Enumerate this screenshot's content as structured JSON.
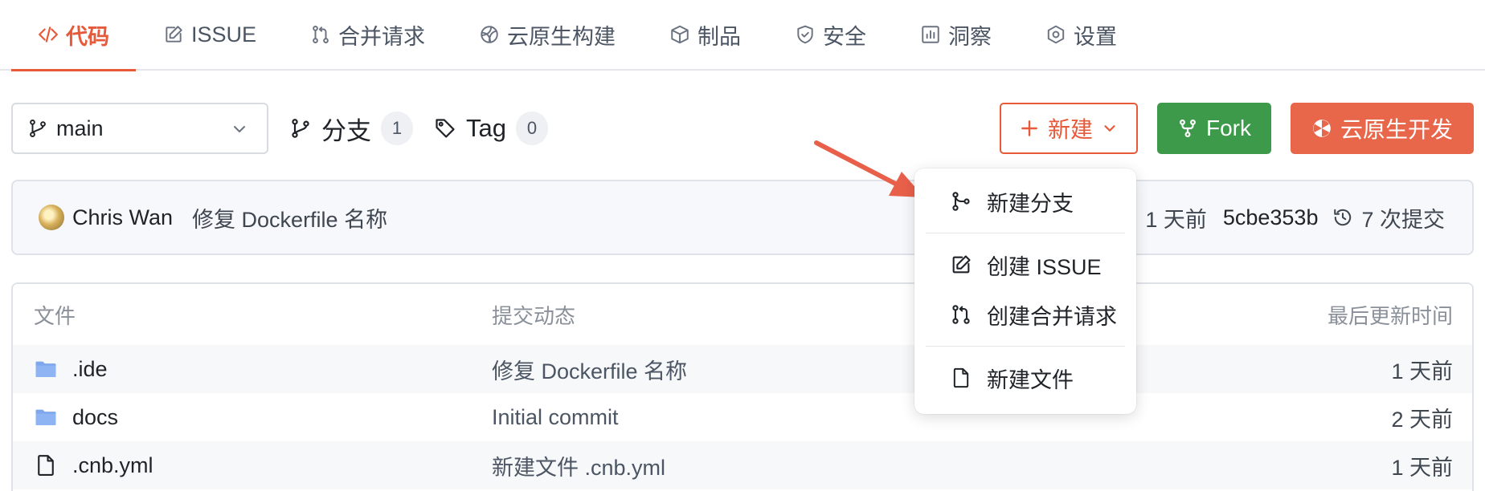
{
  "tabs": [
    {
      "label": "代码",
      "icon": "code-icon",
      "active": true
    },
    {
      "label": "ISSUE",
      "icon": "issue-icon",
      "active": false
    },
    {
      "label": "合并请求",
      "icon": "pull-request-icon",
      "active": false
    },
    {
      "label": "云原生构建",
      "icon": "build-icon",
      "active": false
    },
    {
      "label": "制品",
      "icon": "package-icon",
      "active": false
    },
    {
      "label": "安全",
      "icon": "shield-icon",
      "active": false
    },
    {
      "label": "洞察",
      "icon": "chart-icon",
      "active": false
    },
    {
      "label": "设置",
      "icon": "gear-icon",
      "active": false
    }
  ],
  "toolbar": {
    "branch": "main",
    "branches_label": "分支",
    "branches_count": "1",
    "tags_label": "Tag",
    "tags_count": "0",
    "new_label": "新建",
    "new_prefix": "+",
    "fork_label": "Fork",
    "cloud_dev_label": "云原生开发"
  },
  "commit": {
    "author": "Chris Wan",
    "message": "修复 Dockerfile 名称",
    "time": "1 天前",
    "sha": "5cbe353b",
    "history": "7 次提交"
  },
  "table": {
    "headers": {
      "name": "文件",
      "commit": "提交动态",
      "time": "最后更新时间"
    },
    "rows": [
      {
        "name": ".ide",
        "type": "folder",
        "commit": "修复 Dockerfile 名称",
        "time": "1 天前"
      },
      {
        "name": "docs",
        "type": "folder",
        "commit": "Initial commit",
        "time": "2 天前"
      },
      {
        "name": ".cnb.yml",
        "type": "file",
        "commit": "新建文件 .cnb.yml",
        "time": "1 天前"
      }
    ]
  },
  "dropdown": {
    "items": [
      {
        "label": "新建分支",
        "icon": "branch-icon"
      },
      {
        "label": "创建 ISSUE",
        "icon": "issue-icon"
      },
      {
        "label": "创建合并请求",
        "icon": "pull-request-icon"
      },
      {
        "label": "新建文件",
        "icon": "file-icon"
      }
    ]
  },
  "colors": {
    "accent": "#e65a3a",
    "fork": "#3d9a4b",
    "cloud_dev": "#e8664a",
    "arrow": "#e8604a"
  }
}
